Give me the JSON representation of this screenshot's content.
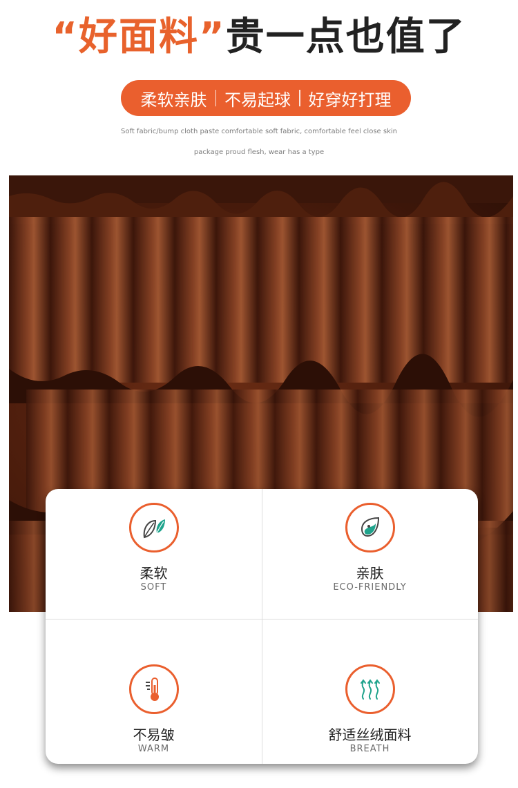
{
  "headline": {
    "accent": "“好面料”",
    "rest": "贵一点也值了"
  },
  "tags": [
    "柔软亲肤",
    "不易起球",
    "好穿好打理"
  ],
  "subtext": [
    "Soft fabric/bump cloth paste comfortable soft fabric, comfortable feel close skin",
    "package proud flesh, wear has a type"
  ],
  "features": [
    {
      "title": "柔软",
      "subtitle": "SOFT",
      "icon": "leaves-icon"
    },
    {
      "title": "亲肤",
      "subtitle": "ECO-FRIENDLY",
      "icon": "leaf-drop-icon"
    },
    {
      "title": "不易皱",
      "subtitle": "WARM",
      "icon": "thermometer-icon"
    },
    {
      "title": "舒适丝绒面料",
      "subtitle": "BREATH",
      "icon": "airflow-icon"
    }
  ],
  "colors": {
    "accent": "#ea5f2e",
    "fabric": "#5a2410",
    "icon_teal": "#1fa38c"
  }
}
